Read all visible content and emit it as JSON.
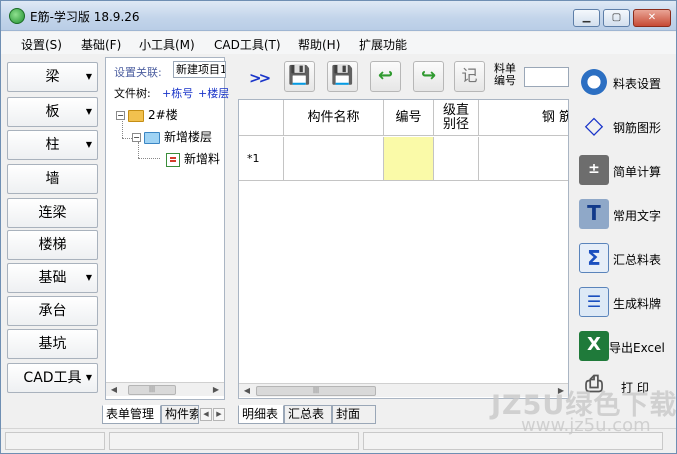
{
  "window": {
    "title": "E筋-学习版 18.9.26"
  },
  "menubar": [
    "设置(S)",
    "基础(F)",
    "小工具(M)",
    "CAD工具(T)",
    "帮助(H)",
    "扩展功能"
  ],
  "left_nav": [
    {
      "label": "梁",
      "dropdown": true
    },
    {
      "label": "板",
      "dropdown": true
    },
    {
      "label": "柱",
      "dropdown": true
    },
    {
      "label": "墙",
      "dropdown": false
    },
    {
      "label": "连梁",
      "dropdown": false
    },
    {
      "label": "楼梯",
      "dropdown": false
    },
    {
      "label": "基础",
      "dropdown": true
    },
    {
      "label": "承台",
      "dropdown": false
    },
    {
      "label": "基坑",
      "dropdown": false
    },
    {
      "label": "CAD工具",
      "dropdown": true
    }
  ],
  "tree_panel": {
    "setting_label": "设置关联:",
    "setting_value": "新建项目1",
    "filetree_label": "文件树:",
    "link_building": "+栋号",
    "link_floor": "+楼层",
    "nodes": [
      "2#楼",
      "新增楼层",
      "新增料"
    ],
    "tabs": [
      "表单管理",
      "构件索"
    ]
  },
  "toolbar": {
    "expand": ">>",
    "buttons": [
      "save-gray-icon",
      "save-blue-icon",
      "undo-arrow-icon",
      "redo-arrow-icon",
      "note-icon"
    ],
    "note_text": "记",
    "num_label": "料单编号",
    "num_value": ""
  },
  "grid": {
    "headers": [
      "构件名称",
      "编号",
      "级直别径",
      "钢 筋"
    ],
    "row_label": "*1",
    "highlight_color": "#fafaa8"
  },
  "grid_tabs": [
    "明细表",
    "汇总表",
    "封面"
  ],
  "right_panel": [
    {
      "label": "料表设置",
      "icon": "gear-icon"
    },
    {
      "label": "钢筋图形",
      "icon": "shape-icon"
    },
    {
      "label": "简单计算",
      "icon": "calculator-icon"
    },
    {
      "label": "常用文字",
      "icon": "text-icon"
    },
    {
      "label": "汇总料表",
      "icon": "sum-icon"
    },
    {
      "label": "生成料牌",
      "icon": "card-icon"
    },
    {
      "label": "导出Excel",
      "icon": "excel-icon"
    },
    {
      "label": "打 印",
      "icon": "printer-icon"
    }
  ],
  "watermark": {
    "text": "JZ5U绿色下载",
    "url": "www.jz5u.com"
  }
}
